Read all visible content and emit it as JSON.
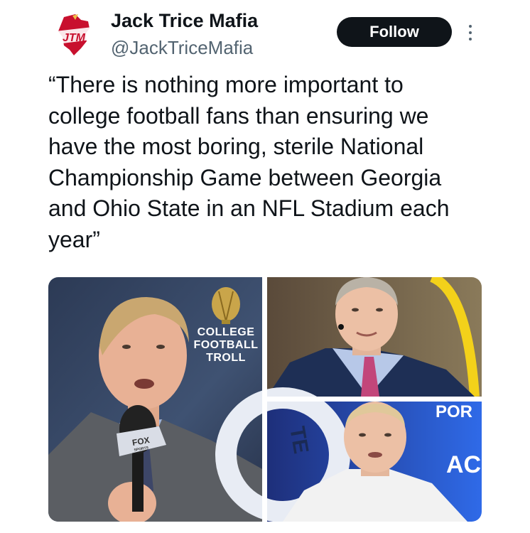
{
  "account": {
    "name": "Jack Trice Mafia",
    "handle": "@JackTriceMafia",
    "avatar_logo_text": "JTM",
    "avatar_icon": "jtm-logo-icon"
  },
  "actions": {
    "follow_label": "Follow",
    "more_icon": "more-options-icon"
  },
  "tweet": {
    "text": "“There is nothing more important to\ncollege football fans than ensuring we\nhave the most boring, sterile National\nChampionship Game between Georgia\nand Ohio State in an NFL Stadium each\nyear”"
  },
  "media": {
    "watermark_lines": [
      "COLLEGE",
      "FOOTBALL",
      "TROLL"
    ],
    "watermark_icon": "trophy-icon",
    "mic_flag_text": "FOX",
    "mic_flag_subtext": "SPORTS",
    "bottom_right_bg_text_left": "TE",
    "bottom_right_bg_text_top": "POR",
    "bottom_right_bg_text_right": "AC",
    "colors": {
      "left_bg": "#3a4a66",
      "suit_gray": "#5b5e63",
      "tr_bg": "#6b6150",
      "goalpost": "#f3d11a",
      "navy_suit": "#1e2f55",
      "pink_tie": "#c2467a",
      "br_blue": "#2853d8",
      "white_shirt": "#f2f2f2"
    }
  }
}
